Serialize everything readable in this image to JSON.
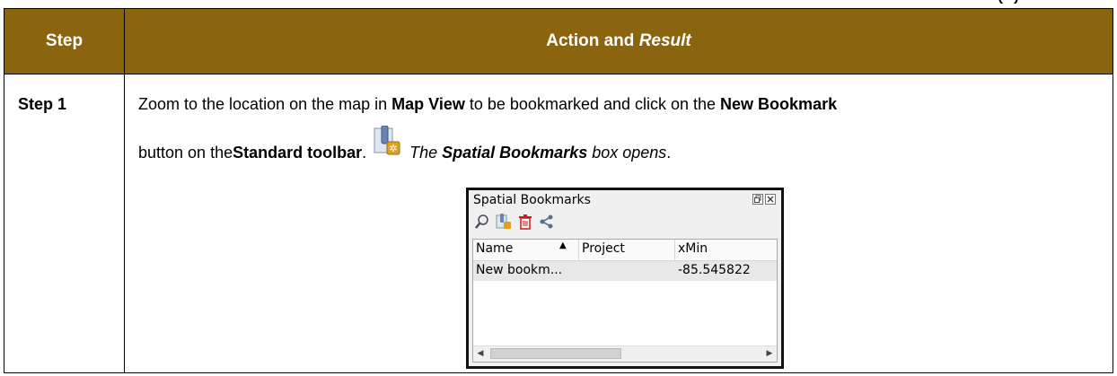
{
  "table": {
    "header_step": "Step",
    "header_action": "Action and ",
    "header_action_em": "Result"
  },
  "row": {
    "step": "Step 1",
    "line1_a": "Zoom to the location on the map in ",
    "line1_b": "Map View",
    "line1_c": " to be bookmarked and click on the ",
    "line1_d": "New Bookmark",
    "line2_a": "button on the ",
    "line2_b": "Standard toolbar",
    "line2_c": ".",
    "line2_d": "The ",
    "line2_e": "Spatial Bookmarks",
    "line2_f": " box opens",
    "line2_g": "."
  },
  "dialog": {
    "title": "Spatial Bookmarks",
    "title_buttons": [
      "restore-icon",
      "close-icon"
    ],
    "tools": [
      "zoom-to-bookmark-icon",
      "new-bookmark-icon",
      "delete-bookmark-icon",
      "share-icon"
    ],
    "columns": [
      "Name",
      "Project",
      "xMin"
    ],
    "sort_column": "Name",
    "rows": [
      {
        "name": "New bookm...",
        "project": "",
        "xmin": "-85.545822"
      }
    ]
  },
  "colors": {
    "header_bg": "#8b6410",
    "header_text": "#ffffff",
    "delete_icon": "#cc1a1a",
    "bookmark_badge": "#e0a020"
  }
}
